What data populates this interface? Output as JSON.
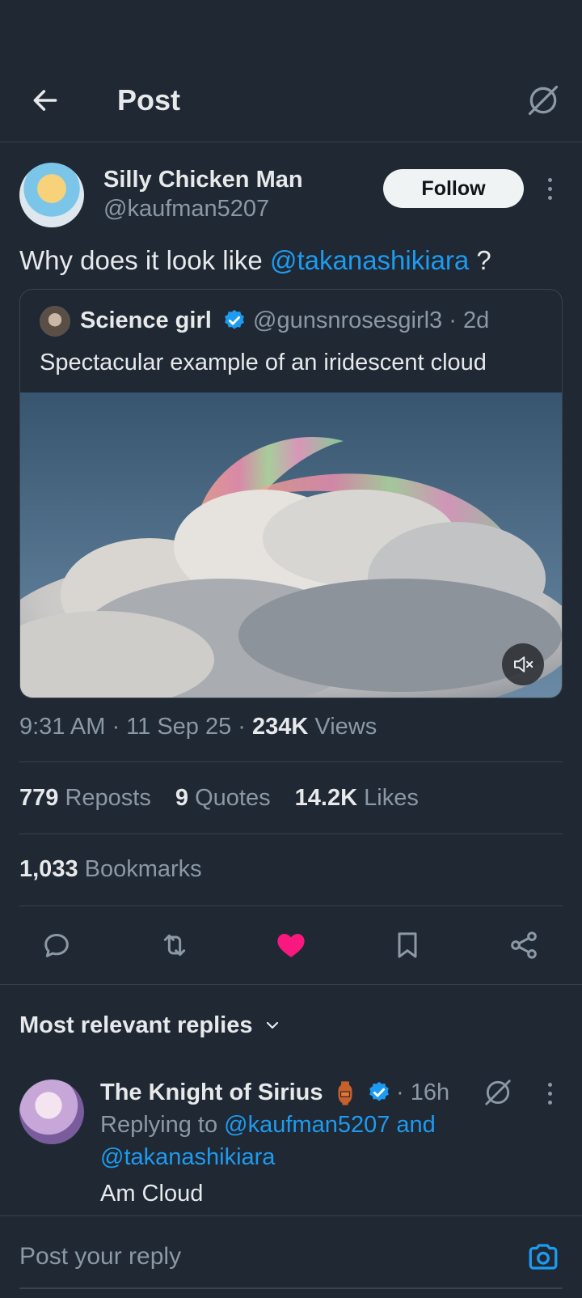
{
  "header": {
    "title": "Post"
  },
  "post": {
    "author_name": "Silly Chicken Man",
    "author_handle": "@kaufman5207",
    "follow_label": "Follow",
    "text_before": "Why does it look like ",
    "mention": "@takanashikiara",
    "text_after": " ?",
    "timestamp": "9:31 AM · 11 Sep 25 · ",
    "views_count": "234K",
    "views_label": " Views"
  },
  "quote": {
    "author_name": "Science girl",
    "handle_time": "@gunsnrosesgirl3 · 2d",
    "text": "Spectacular example of an iridescent cloud",
    "media": "iridescent-cloud-video"
  },
  "stats": {
    "reposts_count": "779",
    "reposts_label": " Reposts",
    "quotes_count": "9",
    "quotes_label": " Quotes",
    "likes_count": "14.2K",
    "likes_label": " Likes",
    "bookmarks_count": "1,033",
    "bookmarks_label": " Bookmarks"
  },
  "actions": [
    "reply-icon",
    "repost-icon",
    "like-icon",
    "bookmark-icon",
    "share-icon"
  ],
  "replies": {
    "filter_label": "Most relevant replies",
    "items": [
      {
        "author_name": "The Knight of Sirius",
        "time": "· 16h",
        "replying_prefix": "Replying to ",
        "replying_to": "@kaufman5207 and @takanashikiara",
        "text": "Am Cloud"
      }
    ]
  },
  "compose": {
    "placeholder": "Post your reply"
  },
  "colors": {
    "background": "#1f2833",
    "accent": "#1d9bf0",
    "like": "#f91880",
    "muted": "#8b98a5",
    "divider": "#38444d"
  }
}
